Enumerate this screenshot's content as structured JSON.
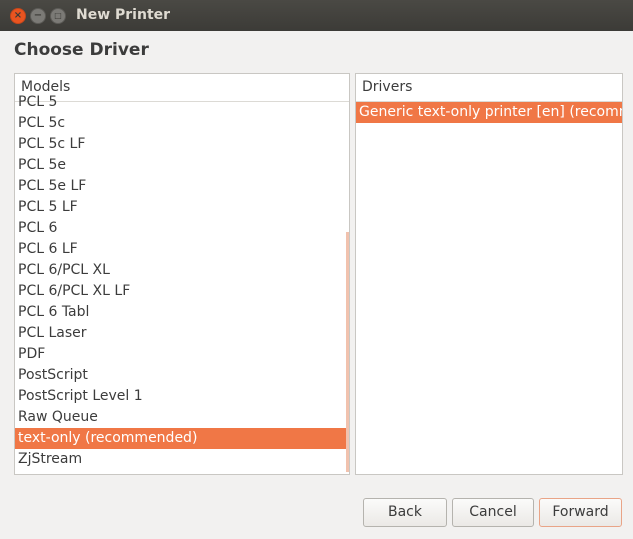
{
  "window": {
    "title": "New Printer"
  },
  "heading": "Choose Driver",
  "models": {
    "header": "Models",
    "items": [
      "PCL 5",
      "PCL 5c",
      "PCL 5c LF",
      "PCL 5e",
      "PCL 5e LF",
      "PCL 5 LF",
      "PCL 6",
      "PCL 6 LF",
      "PCL 6/PCL XL",
      "PCL 6/PCL XL LF",
      "PCL 6 Tabl",
      "PCL Laser",
      "PDF",
      "PostScript",
      "PostScript Level 1",
      "Raw Queue",
      "text-only (recommended)",
      "ZjStream"
    ],
    "selected": "text-only (recommended)"
  },
  "drivers": {
    "header": "Drivers",
    "items": [
      "Generic text-only printer [en] (recommended)"
    ],
    "selected": "Generic text-only printer [en] (recommended)"
  },
  "buttons": {
    "back": "Back",
    "cancel": "Cancel",
    "forward": "Forward"
  },
  "colors": {
    "accent": "#f07746",
    "titlebar": "#3c3b37",
    "close_button": "#e95420"
  }
}
